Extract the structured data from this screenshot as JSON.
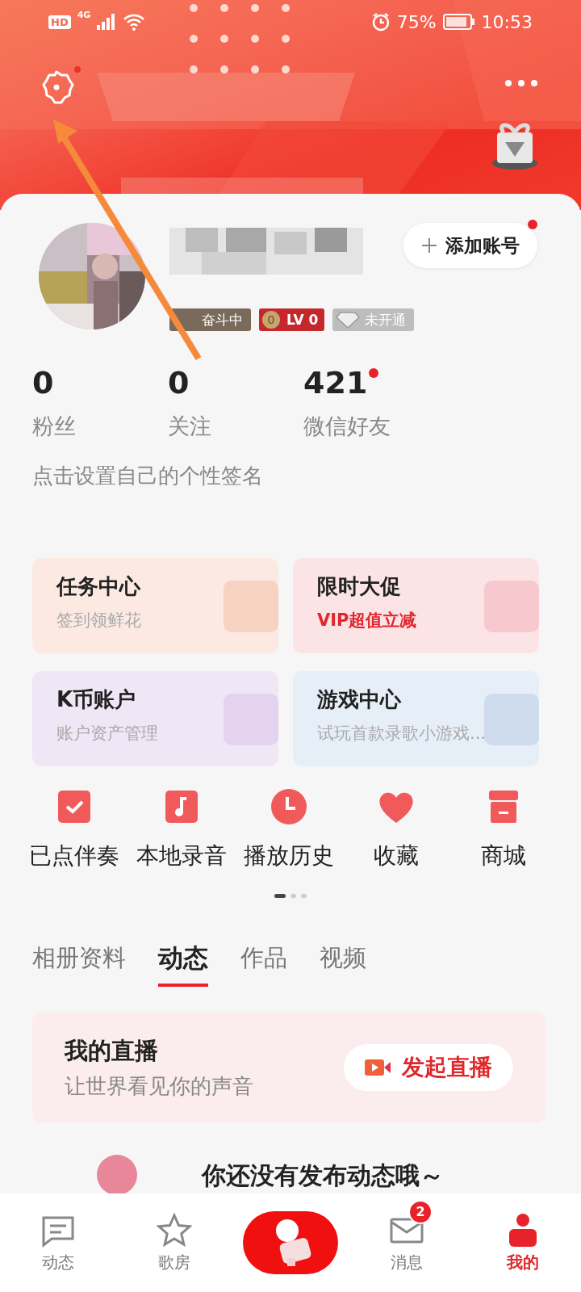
{
  "status_bar": {
    "hd": "HD",
    "network": "4G",
    "battery": "75%",
    "time": "10:53"
  },
  "header": {
    "settings_dot": true
  },
  "profile": {
    "add_account": {
      "label": "添加账号",
      "dot": true
    },
    "badges": [
      {
        "kind": "rank",
        "label": "奋斗中"
      },
      {
        "kind": "level",
        "coin": "0",
        "label": "LV 0"
      },
      {
        "kind": "vip",
        "label": "未开通"
      }
    ]
  },
  "stats": [
    {
      "value": "0",
      "label": "粉丝",
      "dot": false
    },
    {
      "value": "0",
      "label": "关注",
      "dot": false
    },
    {
      "value": "421",
      "label": "微信好友",
      "dot": true
    }
  ],
  "signature_placeholder": "点击设置自己的个性签名",
  "cards": [
    {
      "kind": "task",
      "title": "任务中心",
      "subtitle": "签到领鲜花",
      "highlight": false
    },
    {
      "kind": "promo",
      "title": "限时大促",
      "subtitle": "VIP超值立减",
      "highlight": true
    },
    {
      "kind": "coin",
      "title": "K币账户",
      "subtitle": "账户资产管理",
      "highlight": false
    },
    {
      "kind": "game",
      "title": "游戏中心",
      "subtitle": "试玩首款录歌小游戏...",
      "highlight": false
    }
  ],
  "shortcuts": [
    {
      "kind": "check",
      "label": "已点伴奏"
    },
    {
      "kind": "note",
      "label": "本地录音"
    },
    {
      "kind": "clock",
      "label": "播放历史"
    },
    {
      "kind": "heart",
      "label": "收藏"
    },
    {
      "kind": "shop",
      "label": "商城"
    }
  ],
  "pager": [
    {
      "selected": true
    },
    {
      "selected": false
    },
    {
      "selected": false
    }
  ],
  "tabs": [
    {
      "label": "相册资料",
      "selected": false
    },
    {
      "label": "动态",
      "selected": true
    },
    {
      "label": "作品",
      "selected": false
    },
    {
      "label": "视频",
      "selected": false
    }
  ],
  "live": {
    "title": "我的直播",
    "subtitle": "让世界看见你的声音",
    "button": "发起直播"
  },
  "empty_text": "你还没有发布动态哦～",
  "nav": [
    {
      "kind": "feed",
      "label": "动态",
      "selected": false
    },
    {
      "kind": "star",
      "label": "歌房",
      "selected": false
    },
    {
      "kind": "record",
      "selected": false
    },
    {
      "kind": "mail",
      "label": "消息",
      "selected": false,
      "badge": "2"
    },
    {
      "kind": "me",
      "label": "我的",
      "selected": true
    }
  ]
}
